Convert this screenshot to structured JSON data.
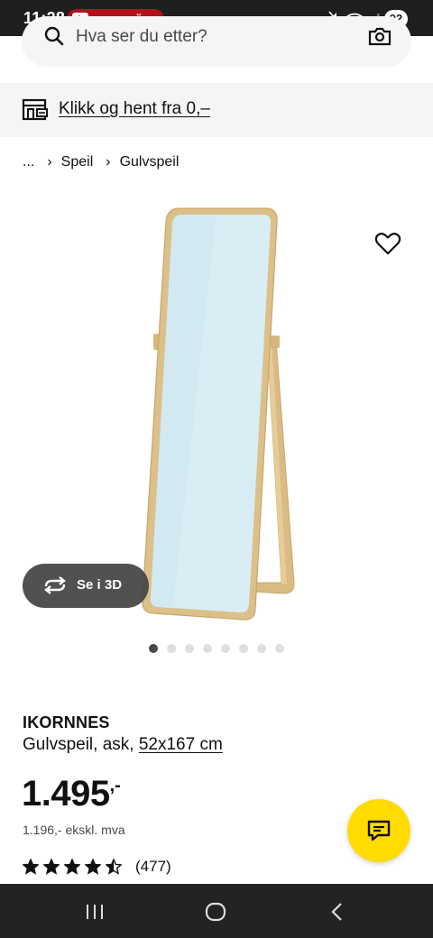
{
  "status_bar": {
    "time": "11:28",
    "notification_text": "еленский",
    "battery": "92",
    "icons": [
      "youtube-icon",
      "mute-icon",
      "wifi-icon",
      "signal-icon"
    ]
  },
  "search": {
    "placeholder": "Hva ser du etter?",
    "icons": [
      "search-icon",
      "camera-icon"
    ]
  },
  "banner": {
    "link_text": "Klikk og hent fra 0,–",
    "icon": "store-icon"
  },
  "breadcrumb": {
    "ellipsis": "...",
    "items": [
      "Speil",
      "Gulvspeil"
    ],
    "separator": "›"
  },
  "gallery": {
    "view3d_label": "Se i 3D",
    "image_count": 8,
    "active_index": 0,
    "favorite_icon": "heart-icon"
  },
  "product": {
    "name": "IKORNNES",
    "description": "Gulvspeil, ask, ",
    "size": "52x167 cm",
    "price_int": "1.495",
    "price_dec": ",-",
    "price_ex_vat": "1.196,- ekskl. mva",
    "rating": 4.5,
    "rating_count": "(477)"
  },
  "chat": {
    "icon": "chat-icon"
  },
  "colors": {
    "brand_yellow": "#ffdb00",
    "text": "#111111",
    "banner_bg": "#f5f5f5",
    "mirror_frame": "#dcc08a",
    "mirror_glass": "#d6ecf5"
  }
}
